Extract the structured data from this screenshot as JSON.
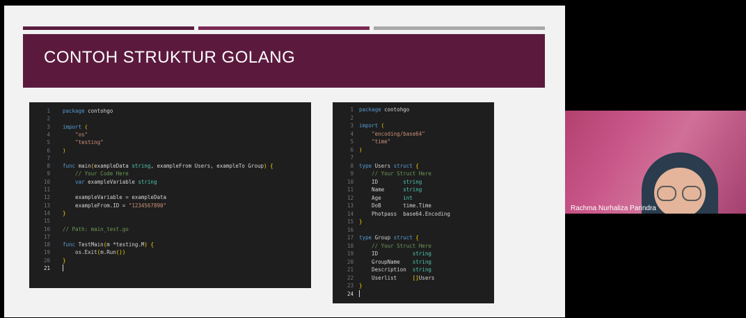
{
  "slide": {
    "title": "CONTOH STRUKTUR GOLANG"
  },
  "code_left": {
    "line_numbers": [
      "1",
      "2",
      "3",
      "4",
      "5",
      "6",
      "7",
      "8",
      "9",
      "10",
      "11",
      "12",
      "13",
      "14",
      "15",
      "16",
      "17",
      "18",
      "19",
      "20",
      "21"
    ],
    "lines": [
      "package contohgo",
      "",
      "import (",
      "    \"os\"",
      "    \"testing\"",
      ")",
      "",
      "func main(exampleData string, exampleFrom Users, exampleTo Group) {",
      "    // Your Code Here",
      "    var exampleVariable string",
      "",
      "    exampleVariable = exampleData",
      "    exampleFrom.ID = \"1234567890\"",
      "}",
      "",
      "// Path: main_test.go",
      "",
      "func TestMain(m *testing.M) {",
      "    os.Exit(m.Run())",
      "}",
      ""
    ]
  },
  "code_right": {
    "line_numbers": [
      "1",
      "2",
      "3",
      "4",
      "5",
      "6",
      "7",
      "8",
      "9",
      "10",
      "11",
      "12",
      "13",
      "14",
      "15",
      "16",
      "17",
      "18",
      "19",
      "20",
      "21",
      "22",
      "23",
      "24"
    ],
    "lines": [
      "package contohgo",
      "",
      "import (",
      "    \"encoding/base64\"",
      "    \"time\"",
      ")",
      "",
      "type Users struct {",
      "    // Your Struct Here",
      "    ID        string",
      "    Name      string",
      "    Age       int",
      "    DoB       time.Time",
      "    Photpass  base64.Encoding",
      "}",
      "",
      "type Group struct {",
      "    // Your Struct Here",
      "    ID           string",
      "    GroupName    string",
      "    Description  string",
      "    Userlist     []Users",
      "}",
      ""
    ]
  },
  "participant": {
    "name": "Rachma Nurhaliza Parindra"
  }
}
